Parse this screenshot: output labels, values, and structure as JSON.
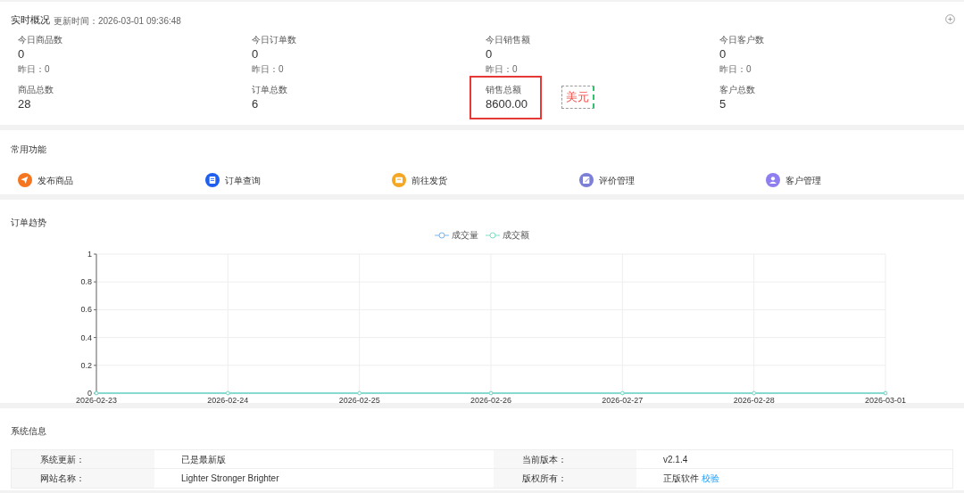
{
  "overview": {
    "title": "实时概况",
    "updated": "更新时间：2026-03-01 09:36:48",
    "today": [
      {
        "label": "今日商品数",
        "value": "0",
        "yesterday": "昨日：0"
      },
      {
        "label": "今日订单数",
        "value": "0",
        "yesterday": "昨日：0"
      },
      {
        "label": "今日销售额",
        "value": "0",
        "yesterday": "昨日：0"
      },
      {
        "label": "今日客户数",
        "value": "0",
        "yesterday": "昨日：0"
      }
    ],
    "totals": [
      {
        "label": "商品总数",
        "value": "28",
        "highlighted": false
      },
      {
        "label": "订单总数",
        "value": "6",
        "highlighted": false
      },
      {
        "label": "销售总额",
        "value": "8600.00",
        "highlighted": true,
        "note": "美元"
      },
      {
        "label": "客户总数",
        "value": "5",
        "highlighted": false
      }
    ]
  },
  "shortcuts": {
    "title": "常用功能",
    "items": [
      {
        "label": "发布商品",
        "kind": "send",
        "color": "#f5761f"
      },
      {
        "label": "订单查询",
        "kind": "clipboard",
        "color": "#1f5ff0"
      },
      {
        "label": "前往发货",
        "kind": "box",
        "color": "#f5a623"
      },
      {
        "label": "评价管理",
        "kind": "edit",
        "color": "#7b7fd8"
      },
      {
        "label": "客户管理",
        "kind": "user",
        "color": "#8e7ef0"
      }
    ]
  },
  "trend": {
    "title": "订单趋势",
    "chart_data": {
      "type": "line",
      "categories": [
        "2026-02-23",
        "2026-02-24",
        "2026-02-25",
        "2026-02-26",
        "2026-02-27",
        "2026-02-28",
        "2026-03-01"
      ],
      "series": [
        {
          "name": "成交量",
          "color": "#7cb5ec",
          "marker": true,
          "values": [
            0,
            0,
            0,
            0,
            0,
            0,
            0
          ]
        },
        {
          "name": "成交额",
          "color": "#7fe0c6",
          "marker": true,
          "values": [
            0,
            0,
            0,
            0,
            0,
            0,
            0
          ]
        }
      ],
      "grid": true,
      "ylim": [
        0,
        1
      ],
      "yticks": [
        0,
        0.2,
        0.4,
        0.6,
        0.8,
        1
      ]
    }
  },
  "system": {
    "title": "系统信息",
    "rows": [
      [
        {
          "label": "系统更新：",
          "value": "已是最新版"
        },
        {
          "label": "当前版本：",
          "value": "v2.1.4"
        }
      ],
      [
        {
          "label": "网站名称：",
          "value": "Lighter Stronger Brighter"
        },
        {
          "label": "版权所有：",
          "value": "正版软件",
          "link": "校验"
        }
      ]
    ]
  }
}
